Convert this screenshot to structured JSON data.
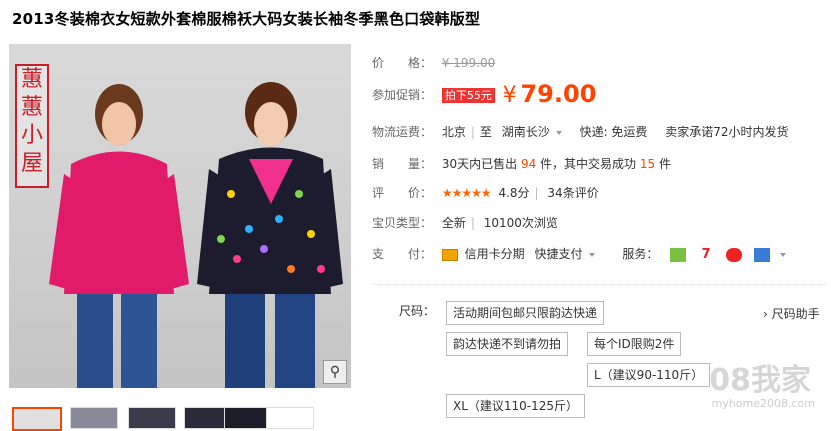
{
  "title": "2013冬装棉衣女短款外套棉服棉袄大码女装长袖冬季黑色口袋韩版型",
  "image": {
    "seal_text": "蕙蕙小屋",
    "zoom_icon": "magnifier-icon"
  },
  "price": {
    "label": "价　　格：",
    "original": "¥ 199.00"
  },
  "promo": {
    "label": "参加促销：",
    "badge": "拍下55元",
    "currency": "¥",
    "amount": "79.00"
  },
  "shipping": {
    "label": "物流运费：",
    "from": "北京",
    "to_prefix": "至",
    "to": "湖南长沙",
    "fee": "快递: 免运费",
    "promise": "卖家承诺72小时内发货"
  },
  "sales": {
    "label": "销　　量：",
    "text1": "30天内已售出",
    "sold": "94",
    "text2": "件，其中交易成功",
    "success": "15",
    "text3": "件"
  },
  "rating": {
    "label": "评　　价：",
    "stars": "★★★★★",
    "score": "4.8分",
    "count": "34条评价"
  },
  "type": {
    "label": "宝贝类型：",
    "value": "全新",
    "views": "10100次浏览"
  },
  "payment": {
    "label": "支　　付：",
    "credit": "信用卡分期",
    "quick": "快捷支付",
    "service_label": "服务："
  },
  "size": {
    "label": "尺码：",
    "helper": "› 尺码助手",
    "options": [
      "活动期间包邮只限韵达快递",
      "韵达快递不到请勿拍",
      "每个ID限购2件",
      "L（建议90-110斤）",
      "XL（建议110-125斤）"
    ]
  },
  "watermark": {
    "text": "08我家",
    "url": "myhome2008.com"
  }
}
